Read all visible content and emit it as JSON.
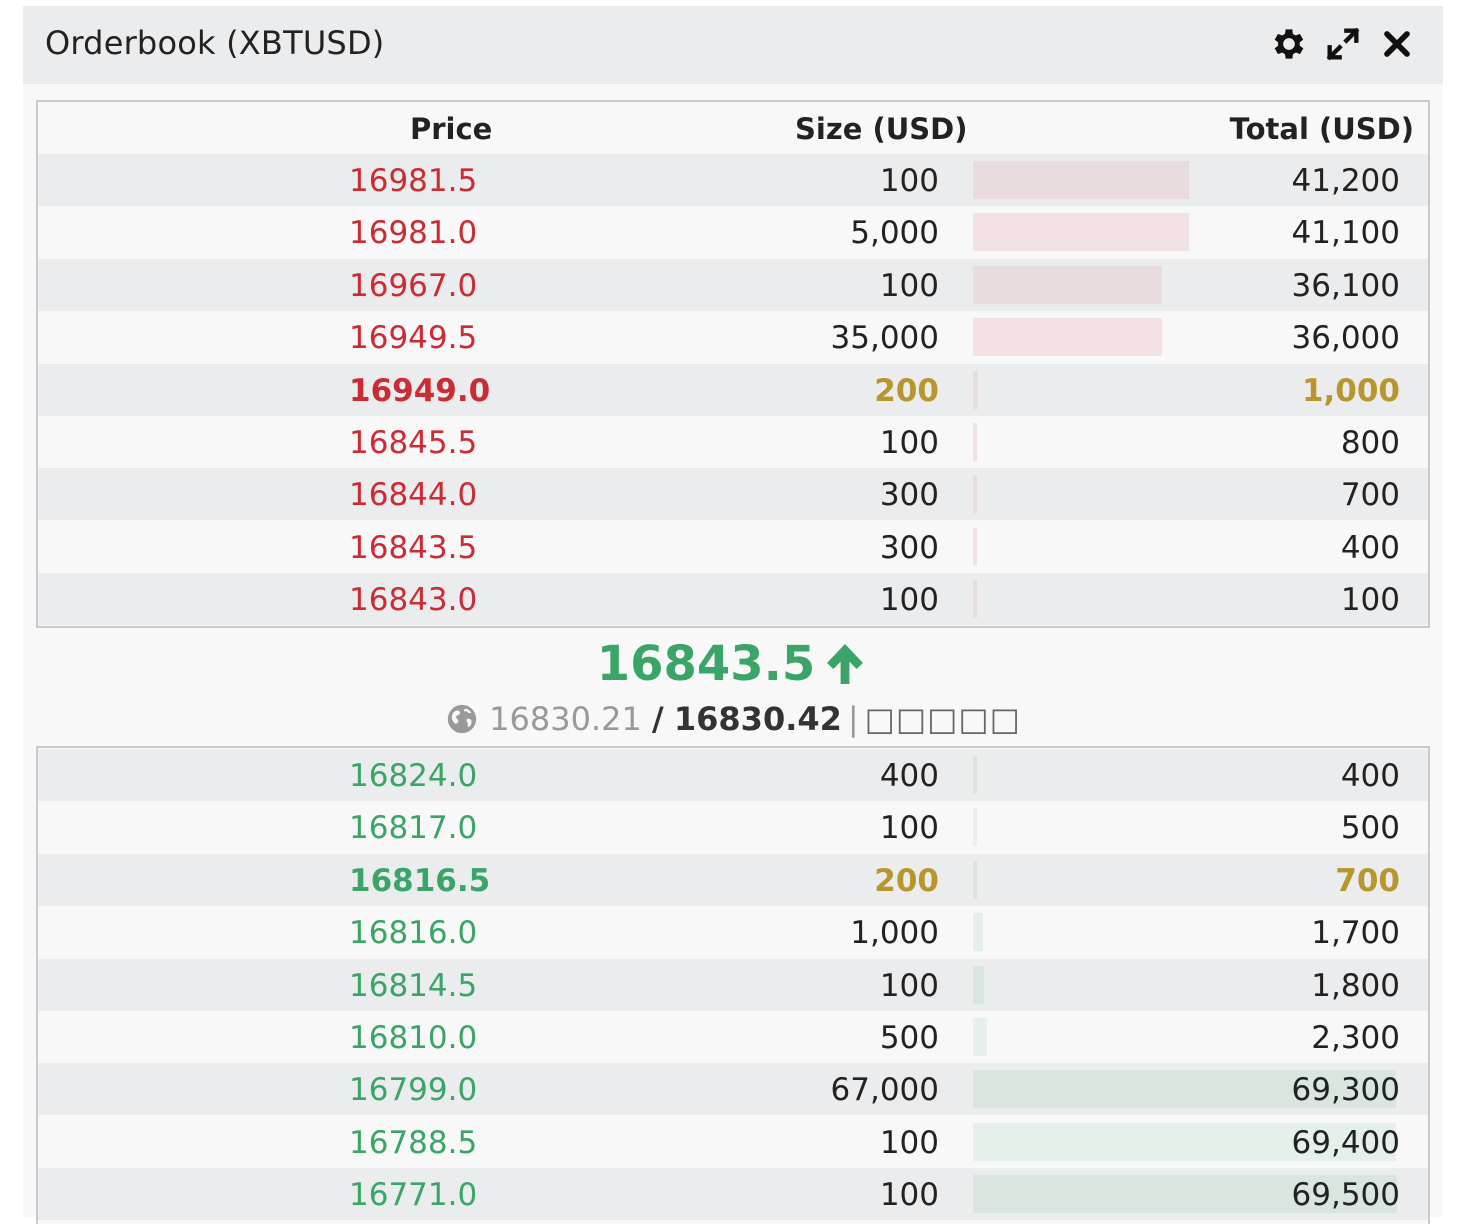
{
  "panel": {
    "title": "Orderbook (XBTUSD)",
    "icons": [
      "gear-icon",
      "expand-icon",
      "close-icon"
    ]
  },
  "columns": {
    "price": "Price",
    "size": "Size (USD)",
    "total": "Total (USD)"
  },
  "colors": {
    "ask": "#cc2b34",
    "bid": "#3aa566",
    "highlight": "#b8962e",
    "row_stripe": "#ebecee"
  },
  "asks": [
    {
      "price": "16981.5",
      "size": "100",
      "total": "41,200"
    },
    {
      "price": "16981.0",
      "size": "5,000",
      "total": "41,100"
    },
    {
      "price": "16967.0",
      "size": "100",
      "total": "36,100"
    },
    {
      "price": "16949.5",
      "size": "35,000",
      "total": "36,000"
    },
    {
      "price": "16949.0",
      "size": "200",
      "total": "1,000",
      "highlight": true
    },
    {
      "price": "16845.5",
      "size": "100",
      "total": "800"
    },
    {
      "price": "16844.0",
      "size": "300",
      "total": "700"
    },
    {
      "price": "16843.5",
      "size": "300",
      "total": "400"
    },
    {
      "price": "16843.0",
      "size": "100",
      "total": "100"
    }
  ],
  "last_trade": {
    "price": "16843.5",
    "direction_icon": "arrow-up-icon"
  },
  "index": {
    "icon": "globe-icon",
    "index_price": "16830.21",
    "separator": "/",
    "mark_price": "16830.42",
    "divider": "|",
    "label": "□□□□□"
  },
  "bids": [
    {
      "price": "16824.0",
      "size": "400",
      "total": "400"
    },
    {
      "price": "16817.0",
      "size": "100",
      "total": "500"
    },
    {
      "price": "16816.5",
      "size": "200",
      "total": "700",
      "highlight": true
    },
    {
      "price": "16816.0",
      "size": "1,000",
      "total": "1,700"
    },
    {
      "price": "16814.5",
      "size": "100",
      "total": "1,800"
    },
    {
      "price": "16810.0",
      "size": "500",
      "total": "2,300"
    },
    {
      "price": "16799.0",
      "size": "67,000",
      "total": "69,300"
    },
    {
      "price": "16788.5",
      "size": "100",
      "total": "69,400"
    },
    {
      "price": "16771.0",
      "size": "100",
      "total": "69,500"
    }
  ]
}
